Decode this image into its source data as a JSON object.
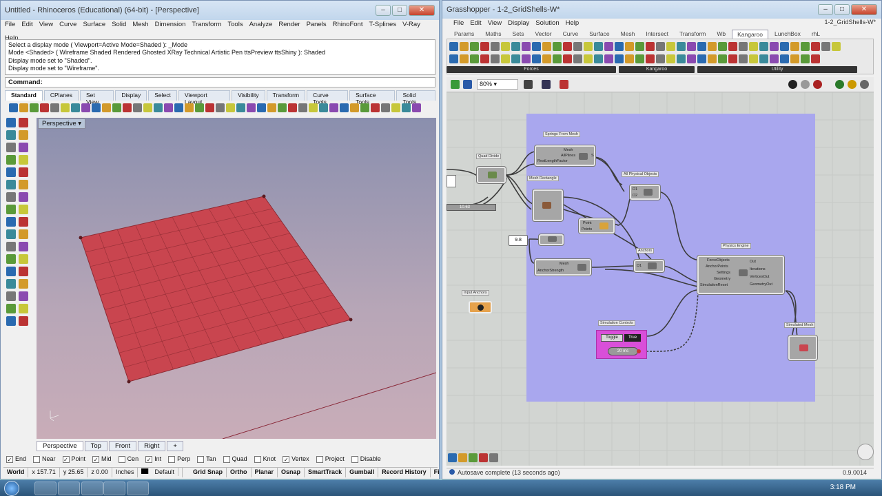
{
  "rhino": {
    "title": "Untitled - Rhinoceros (Educational) (64-bit) - [Perspective]",
    "menus": [
      "File",
      "Edit",
      "View",
      "Curve",
      "Surface",
      "Solid",
      "Mesh",
      "Dimension",
      "Transform",
      "Tools",
      "Analyze",
      "Render",
      "Panels",
      "RhinoFont",
      "T-Splines",
      "V-Ray",
      "Help"
    ],
    "console_lines": [
      "Select a display mode ( Viewport=Active  Mode=Shaded ):  _Mode",
      "Mode <Shaded> ( Wireframe  Shaded  Rendered  Ghosted  XRay  Technical  Artistic  Pen  ttsPreview  ttsShiny ): Shaded",
      "Display mode set to \"Shaded\".",
      "Display mode set to \"Wireframe\"."
    ],
    "command_label": "Command:",
    "toolbar_tabs": [
      "Standard",
      "CPlanes",
      "Set View",
      "Display",
      "Select",
      "Viewport Layout",
      "Visibility",
      "Transform",
      "Curve Tools",
      "Surface Tools",
      "Solid Tools"
    ],
    "viewport_name": "Perspective",
    "viewport_tabs": [
      "Perspective",
      "Top",
      "Front",
      "Right",
      "+"
    ],
    "osnaps": [
      {
        "label": "End",
        "checked": true
      },
      {
        "label": "Near",
        "checked": false
      },
      {
        "label": "Point",
        "checked": true
      },
      {
        "label": "Mid",
        "checked": true
      },
      {
        "label": "Cen",
        "checked": false
      },
      {
        "label": "Int",
        "checked": true
      },
      {
        "label": "Perp",
        "checked": false
      },
      {
        "label": "Tan",
        "checked": false
      },
      {
        "label": "Quad",
        "checked": false
      },
      {
        "label": "Knot",
        "checked": false
      },
      {
        "label": "Vertex",
        "checked": true
      },
      {
        "label": "Project",
        "checked": false
      },
      {
        "label": "Disable",
        "checked": false
      }
    ],
    "status": {
      "cplane": "World",
      "x": "x 157.71",
      "y": "y 25.65",
      "z": "z 0.00",
      "units": "Inches",
      "layer": "Default",
      "toggles": [
        "Grid Snap",
        "Ortho",
        "Planar",
        "Osnap",
        "SmartTrack",
        "Gumball",
        "Record History",
        "Filter"
      ]
    }
  },
  "grasshopper": {
    "title": "Grasshopper - 1-2_GridShells-W*",
    "doc_name": "1-2_GridShells-W*",
    "menus": [
      "File",
      "Edit",
      "View",
      "Display",
      "Solution",
      "Help"
    ],
    "tabs": [
      "Params",
      "Maths",
      "Sets",
      "Vector",
      "Curve",
      "Surface",
      "Mesh",
      "Intersect",
      "Transform",
      "Wb",
      "Kangaroo",
      "LunchBox",
      "rhL"
    ],
    "active_tab": "Kangaroo",
    "groups": [
      "Forces",
      "Kangaroo",
      "Utility"
    ],
    "zoom": "80%",
    "components": {
      "springs_from_mesh": {
        "title": "Springs From Mesh",
        "inputs": [
          "Mesh",
          "RestLengthFactor"
        ],
        "outputs": [
          "AllPlines",
          "S"
        ]
      },
      "quad_divide": {
        "title": "Quad Divide"
      },
      "mesh_rectangle": {
        "title": "Mesh Rectangle"
      },
      "all_physical": {
        "title": "All Physical Objects",
        "inputs": [
          "D1",
          "D2"
        ]
      },
      "point": {
        "title": "Point",
        "label": "Points"
      },
      "slider": {
        "value": "9.8"
      },
      "anchors": {
        "title": "Anchors",
        "inputs": [
          "Mesh",
          "AnchorStrength"
        ],
        "label": "D1"
      },
      "input_anchors": {
        "title": "Input Anchors"
      },
      "physics_engine": {
        "title": "Physics Engine",
        "inputs": [
          "ForceObjects",
          "AnchorPoints",
          "Settings",
          "Geometry",
          "SimulationReset"
        ],
        "outputs": [
          "Out",
          "Iterations",
          "VerticesOut",
          "GeometryOut"
        ]
      },
      "sim_controls": {
        "title": "Simulation Controls",
        "buttons": [
          "Toggle",
          "True"
        ],
        "timer": "20 ms"
      },
      "simulated_mesh": {
        "title": "Simulated Mesh"
      },
      "small_number": {
        "value": "10.63"
      }
    },
    "status": "Autosave complete (13 seconds ago)",
    "version": "0.9.0014"
  },
  "taskbar": {
    "time": "3:18 PM"
  },
  "colors": {
    "mesh": "#c9454f",
    "group": "#a9a7ee",
    "gh_canvas": "#d2d5d2"
  }
}
